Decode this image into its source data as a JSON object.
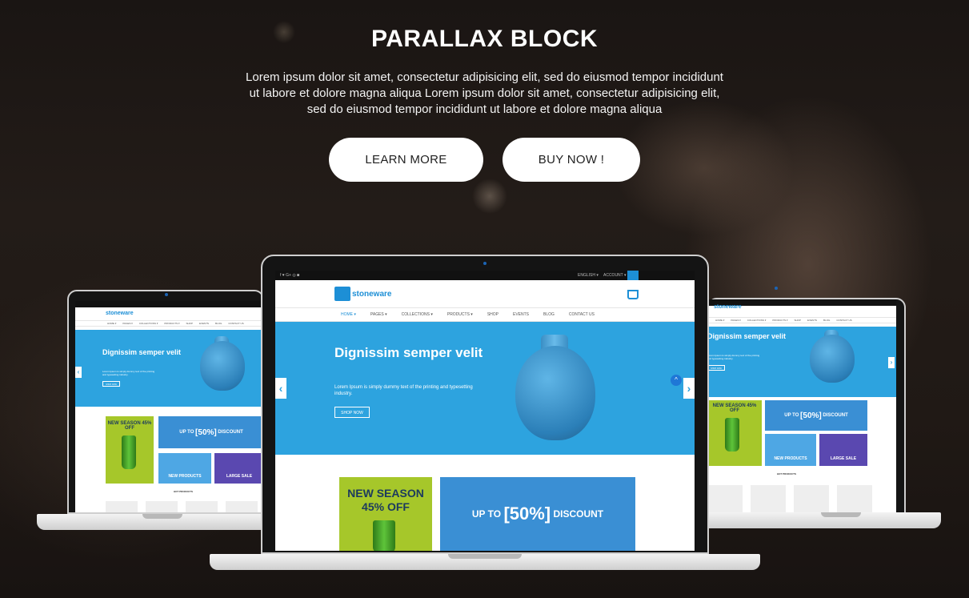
{
  "hero": {
    "title": "PARALLAX BLOCK",
    "description": "Lorem ipsum dolor sit amet, consectetur adipisicing elit, sed do eiusmod tempor incididunt ut labore et dolore magna aliqua Lorem ipsum dolor sit amet, consectetur adipisicing elit, sed do eiusmod tempor incididunt ut labore et dolore magna aliqua",
    "learn_more": "LEARN MORE",
    "buy_now": "BUY NOW !"
  },
  "site": {
    "logo": "stoneware",
    "topbar": {
      "social": "f  ♥  G+  ◎  ◙",
      "language": "ENGLISH ▾",
      "account": "ACCOUNT ▾"
    },
    "nav": [
      "HOME ▾",
      "PAGES ▾",
      "COLLECTIONS ▾",
      "PRODUCTS ▾",
      "SHOP",
      "EVENTS",
      "BLOG",
      "CONTACT US"
    ],
    "slide": {
      "heading": "Dignissim semper velit",
      "text": "Lorem Ipsum is simply dummy text of the printing and typesetting industry.",
      "button": "SHOP NOW"
    },
    "promo_season": "NEW SEASON 45% OFF",
    "promo_discount_prefix": "UP TO",
    "promo_discount_value": "[50%]",
    "promo_discount_suffix": "DISCOUNT",
    "promo_new_products": "NEW PRODUCTS",
    "promo_large_sale": "LARGE SALE",
    "hot_products": "HOT PRODUCTS"
  },
  "colors": {
    "accent": "#2da3df",
    "green": "#a6c72a",
    "button_bg": "#ffffff"
  }
}
